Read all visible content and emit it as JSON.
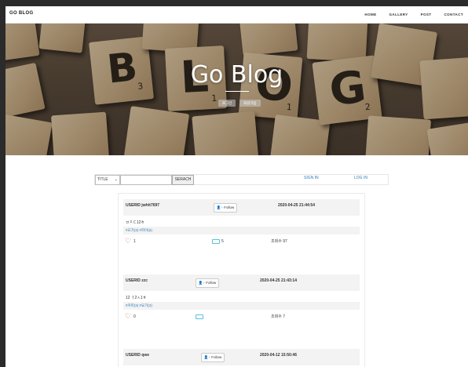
{
  "nav": {
    "brand": "GO BLOG",
    "items": [
      "HOME",
      "GALLERY",
      "POST",
      "CONTACT"
    ]
  },
  "hero": {
    "title": "Go Blog",
    "buttons": [
      "로그인",
      "회원가입"
    ]
  },
  "search": {
    "select_value": "TITLE",
    "input_value": "",
    "button_label": "SERACH",
    "sign_in": "SIGN IN",
    "log_in": "LOG IN"
  },
  "posts": [
    {
      "userid": "USERID   jwhtt7697",
      "follow": "Follow",
      "date": "2020-04-25 21:44:54",
      "title": "ㅂㅈㄷ12ㅎ",
      "tags": "#요가(3) #피아(5)",
      "likes": "1",
      "comments": "5",
      "views": "조회수   97"
    },
    {
      "userid": "USERID   zzc",
      "follow": "Follow",
      "date": "2020-04-25 21:43:14",
      "title": "12 ㅓ2ㅅ1ㅎ",
      "tags": "#커피(3) #요가(3)",
      "likes": "0",
      "comments": "",
      "views": "조회수   7"
    },
    {
      "userid": "USERID   qwe",
      "follow": "Follow",
      "date": "2020-04-12 15:50:46"
    }
  ],
  "colors": {
    "link": "#337ab7",
    "accent": "#5bc0de",
    "heart": "#d9534f"
  }
}
